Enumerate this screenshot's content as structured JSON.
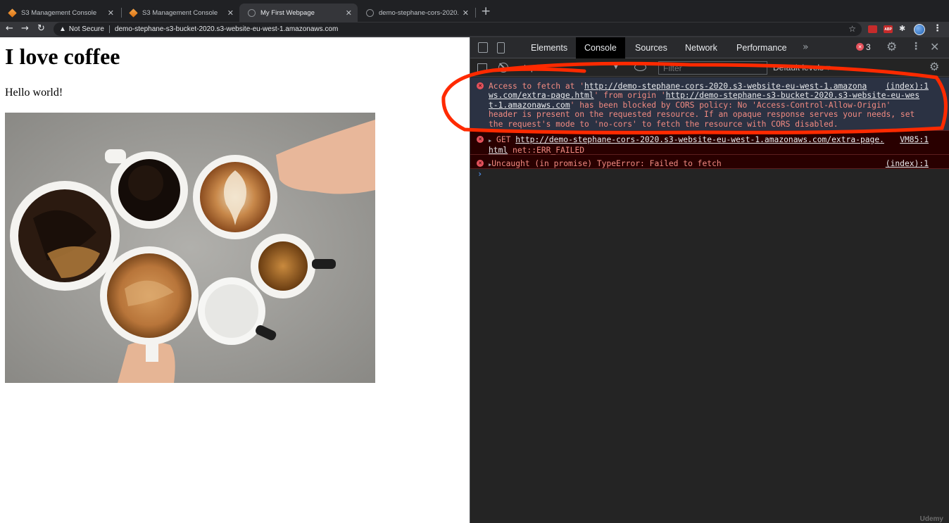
{
  "tabs": [
    {
      "title": "S3 Management Console",
      "icon": "aws-cube-icon"
    },
    {
      "title": "S3 Management Console",
      "icon": "aws-cube-icon"
    },
    {
      "title": "My First Webpage",
      "icon": "globe-icon"
    },
    {
      "title": "demo-stephane-cors-2020.s3",
      "icon": "globe-icon"
    }
  ],
  "toolbar": {
    "not_secure": "Not Secure",
    "url": "demo-stephane-s3-bucket-2020.s3-website-eu-west-1.amazonaws.com",
    "ext_abp": "ABP"
  },
  "page": {
    "heading": "I love coffee",
    "paragraph": "Hello world!",
    "image": "coffee-cups-photo"
  },
  "devtools": {
    "tabs": [
      "Elements",
      "Console",
      "Sources",
      "Network",
      "Performance"
    ],
    "active_tab": "Console",
    "more": "»",
    "error_count": "3",
    "context": "top",
    "filter_placeholder": "Filter",
    "levels": "Default levels ▾",
    "messages": [
      {
        "l1": "Access to fetch at '",
        "l1_link": "http://demo-stephane-cors-2020.s3-website-eu-west-1.amazona",
        "l2_link": "ws.com/extra-page.html",
        "l2_mid": "' from origin '",
        "l2_link2": "http://demo-stephane-s3-bucket-2020.s3-website-eu-wes",
        "l3_link": "t-1.amazonaws.com",
        "l3": "' has been blocked by CORS policy: No 'Access-Control-Allow-Origin'",
        "l4": "header is present on the requested resource. If an opaque response serves your needs, set",
        "l5": "the request's mode to 'no-cors' to fetch the resource with CORS disabled.",
        "source": "(index):1"
      },
      {
        "method": "GET",
        "url_part1": "http://demo-stephane-cors-2020.s3-website-eu-west-1.amazonaws.com/extra-page.",
        "url_part2": "html",
        "status": "net::ERR_FAILED",
        "source": "VM85:1"
      },
      {
        "text": "Uncaught (in promise) TypeError: Failed to fetch",
        "source": "(index):1"
      }
    ],
    "prompt": "›"
  },
  "watermark": "Udemy",
  "colors": {
    "annotation": "#ff2a00",
    "error_red": "#e4525c",
    "focused_bg": "#2b3243",
    "error_bg": "#290000"
  }
}
